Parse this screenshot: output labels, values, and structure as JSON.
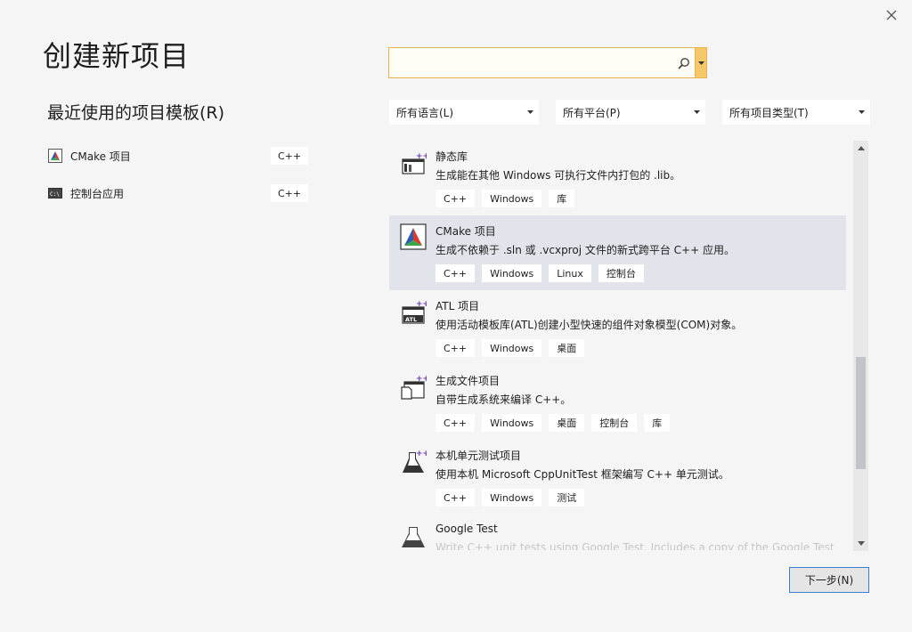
{
  "window": {
    "title": "创建新项目",
    "close_icon": "close-icon"
  },
  "recent": {
    "title": "最近使用的项目模板",
    "title_hotkey": "(R)",
    "items": [
      {
        "label": "CMake 项目",
        "tag": "C++",
        "icon": "cmake-icon"
      },
      {
        "label": "控制台应用",
        "tag": "C++",
        "icon": "console-icon"
      }
    ]
  },
  "search": {
    "value": "",
    "icon": "search-icon"
  },
  "filters": [
    {
      "label": "所有语言(L)"
    },
    {
      "label": "所有平台(P)"
    },
    {
      "label": "所有项目类型(T)"
    }
  ],
  "templates": [
    {
      "name": "静态库",
      "desc": "生成能在其他 Windows 可执行文件内打包的 .lib。",
      "tags": [
        "C++",
        "Windows",
        "库"
      ],
      "icon": "static-library-icon",
      "selected": false
    },
    {
      "name": "CMake 项目",
      "desc": "生成不依赖于 .sln 或 .vcxproj 文件的新式跨平台 C++ 应用。",
      "tags": [
        "C++",
        "Windows",
        "Linux",
        "控制台"
      ],
      "icon": "cmake-icon",
      "selected": true
    },
    {
      "name": "ATL 项目",
      "desc": "使用活动模板库(ATL)创建小型快速的组件对象模型(COM)对象。",
      "tags": [
        "C++",
        "Windows",
        "桌面"
      ],
      "icon": "atl-icon",
      "selected": false
    },
    {
      "name": "生成文件项目",
      "desc": "自带生成系统来编译 C++。",
      "tags": [
        "C++",
        "Windows",
        "桌面",
        "控制台",
        "库"
      ],
      "icon": "makefile-icon",
      "selected": false
    },
    {
      "name": "本机单元测试项目",
      "desc": "使用本机 Microsoft CppUnitTest 框架编写 C++ 单元测试。",
      "tags": [
        "C++",
        "Windows",
        "测试"
      ],
      "icon": "unit-test-flask-icon",
      "selected": false
    },
    {
      "name": "Google Test",
      "desc": "Write C++ unit tests using Google Test. Includes a copy of the Google Test",
      "tags": [],
      "icon": "google-test-flask-icon",
      "selected": false
    }
  ],
  "actions": {
    "next_label": "下一步(N)"
  }
}
